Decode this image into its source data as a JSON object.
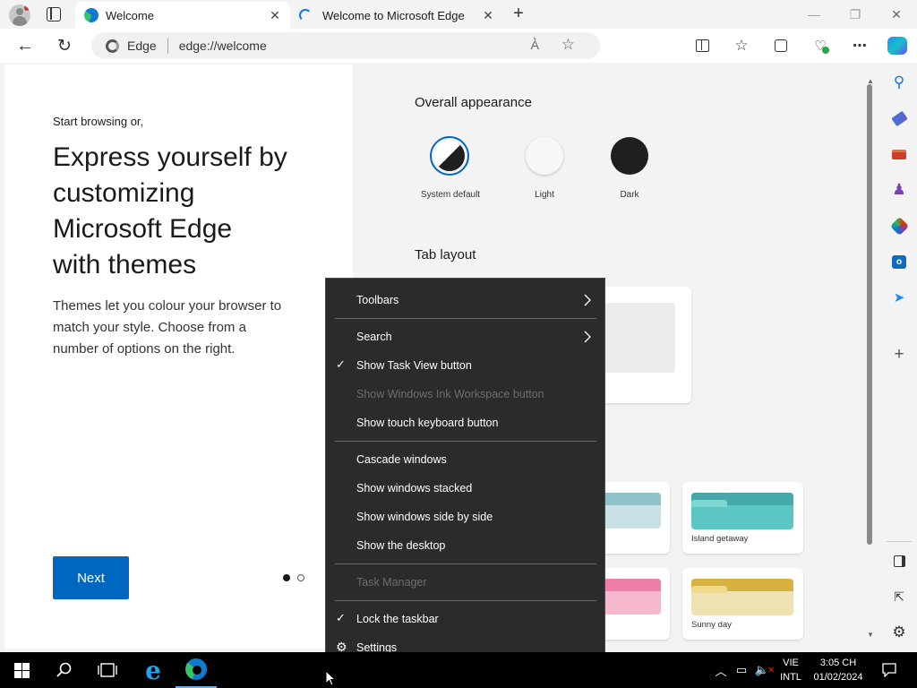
{
  "browser": {
    "tabs": [
      {
        "title": "Welcome",
        "active": true
      },
      {
        "title": "Welcome to Microsoft Edge",
        "active": false
      }
    ],
    "address": {
      "site_label": "Edge",
      "url": "edge://welcome"
    }
  },
  "welcome": {
    "kicker": "Start browsing or,",
    "heading_lines": [
      "Express yourself by",
      "customizing",
      "Microsoft Edge",
      "with themes"
    ],
    "body_lines": [
      "Themes let you colour your browser to",
      "match your style. Choose from a",
      "number of options on the right."
    ],
    "next_label": "Next"
  },
  "appearance": {
    "title": "Overall appearance",
    "options": [
      "System default",
      "Light",
      "Dark"
    ],
    "tab_layout_title": "Tab layout"
  },
  "themes": [
    {
      "name": "Island getaway",
      "color": "#5cc6c4"
    },
    {
      "name": "Sunny day",
      "color": "#d8b23f"
    }
  ],
  "context_menu": {
    "items": [
      {
        "label": "Toolbars",
        "submenu": true
      },
      {
        "label": "Search",
        "submenu": true
      },
      {
        "label": "Show Task View button",
        "checked": true
      },
      {
        "label": "Show Windows Ink Workspace button",
        "disabled": true
      },
      {
        "label": "Show touch keyboard button"
      },
      {
        "label": "Cascade windows"
      },
      {
        "label": "Show windows stacked"
      },
      {
        "label": "Show windows side by side"
      },
      {
        "label": "Show the desktop"
      },
      {
        "label": "Task Manager",
        "disabled": true
      },
      {
        "label": "Lock the taskbar",
        "checked": true
      },
      {
        "label": "Settings",
        "icon": "gear-icon"
      }
    ]
  },
  "taskbar": {
    "lang_top": "VIE",
    "lang_bottom": "INTL",
    "time": "3:05 CH",
    "date": "01/02/2024"
  },
  "colors": {
    "accent": "#0067c0",
    "menu_bg": "#2b2b2b",
    "taskbar_bg": "#000000"
  }
}
